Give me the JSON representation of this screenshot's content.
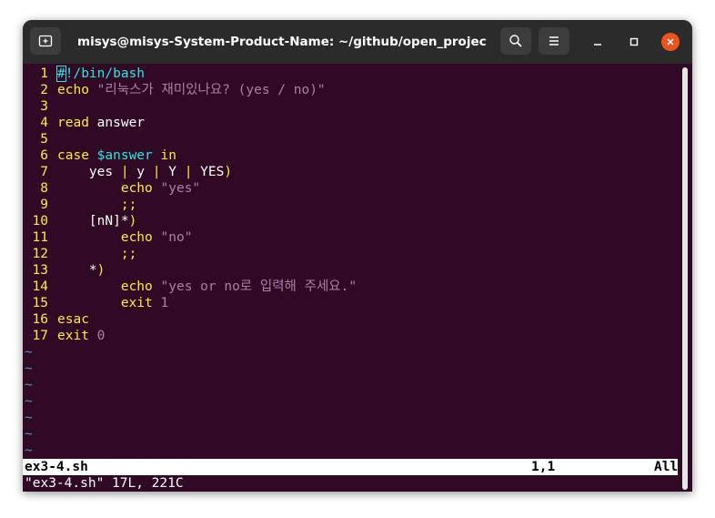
{
  "window": {
    "title": "misys@misys-System-Product-Name: ~/github/open_project_...",
    "new_tab_icon": "new-tab-icon",
    "search_icon": "search-icon",
    "menu_icon": "hamburger-menu-icon",
    "minimize_icon": "minimize-icon",
    "maximize_icon": "maximize-icon",
    "close_icon": "close-icon"
  },
  "colors": {
    "terminal_bg": "#300a24",
    "keyword": "#fce94f",
    "string": "#ad7fa8",
    "comment": "#34e2e2",
    "tilde": "#5c8cc8",
    "close_btn": "#e95420"
  },
  "editor": {
    "lines": [
      {
        "num": "1",
        "tokens": [
          [
            "cursor",
            "#"
          ],
          [
            "comment",
            "!/bin/bash"
          ]
        ]
      },
      {
        "num": "2",
        "tokens": [
          [
            "kw",
            "echo"
          ],
          [
            "text",
            " "
          ],
          [
            "str",
            "\"리눅스가 재미있나요? (yes / no)\""
          ]
        ]
      },
      {
        "num": "3",
        "tokens": []
      },
      {
        "num": "4",
        "tokens": [
          [
            "kw",
            "read"
          ],
          [
            "text",
            " answer"
          ]
        ]
      },
      {
        "num": "5",
        "tokens": []
      },
      {
        "num": "6",
        "tokens": [
          [
            "kw",
            "case"
          ],
          [
            "text",
            " "
          ],
          [
            "var",
            "$answer"
          ],
          [
            "text",
            " "
          ],
          [
            "kw",
            "in"
          ]
        ]
      },
      {
        "num": "7",
        "tokens": [
          [
            "text",
            "    yes "
          ],
          [
            "kw",
            "|"
          ],
          [
            "text",
            " y "
          ],
          [
            "kw",
            "|"
          ],
          [
            "text",
            " Y "
          ],
          [
            "kw",
            "|"
          ],
          [
            "text",
            " YES"
          ],
          [
            "kw",
            ")"
          ]
        ]
      },
      {
        "num": "8",
        "tokens": [
          [
            "text",
            "        "
          ],
          [
            "kw",
            "echo"
          ],
          [
            "text",
            " "
          ],
          [
            "str",
            "\"yes\""
          ]
        ]
      },
      {
        "num": "9",
        "tokens": [
          [
            "text",
            "        "
          ],
          [
            "kw",
            ";;"
          ]
        ]
      },
      {
        "num": "10",
        "tokens": [
          [
            "text",
            "    [nN]*"
          ],
          [
            "kw",
            ")"
          ]
        ]
      },
      {
        "num": "11",
        "tokens": [
          [
            "text",
            "        "
          ],
          [
            "kw",
            "echo"
          ],
          [
            "text",
            " "
          ],
          [
            "str",
            "\"no\""
          ]
        ]
      },
      {
        "num": "12",
        "tokens": [
          [
            "text",
            "        "
          ],
          [
            "kw",
            ";;"
          ]
        ]
      },
      {
        "num": "13",
        "tokens": [
          [
            "text",
            "    *"
          ],
          [
            "kw",
            ")"
          ]
        ]
      },
      {
        "num": "14",
        "tokens": [
          [
            "text",
            "        "
          ],
          [
            "kw",
            "echo"
          ],
          [
            "text",
            " "
          ],
          [
            "str",
            "\"yes or no로 입력해 주세요.\""
          ]
        ]
      },
      {
        "num": "15",
        "tokens": [
          [
            "text",
            "        "
          ],
          [
            "kw",
            "exit"
          ],
          [
            "text",
            " "
          ],
          [
            "num",
            "1"
          ]
        ]
      },
      {
        "num": "16",
        "tokens": [
          [
            "kw",
            "esac"
          ]
        ]
      },
      {
        "num": "17",
        "tokens": [
          [
            "kw",
            "exit"
          ],
          [
            "text",
            " "
          ],
          [
            "num",
            "0"
          ]
        ]
      }
    ],
    "tildes": [
      "~",
      "~",
      "~",
      "~",
      "~",
      "~",
      "~"
    ]
  },
  "status": {
    "filename": "ex3-4.sh",
    "position": "1,1",
    "scroll": "All"
  },
  "message": "\"ex3-4.sh\" 17L, 221C"
}
